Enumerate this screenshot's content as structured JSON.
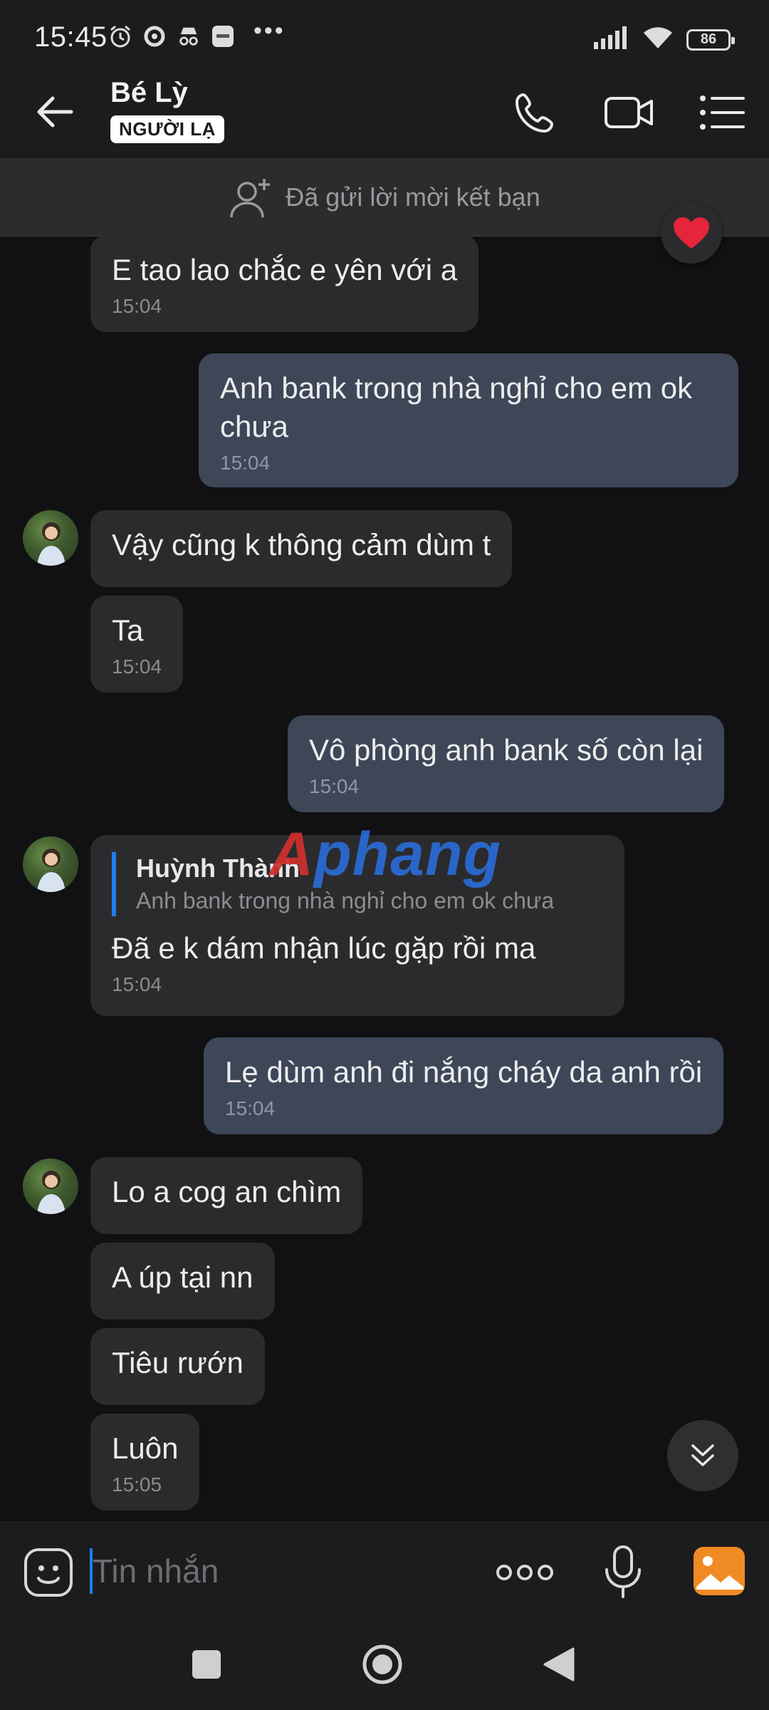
{
  "status_bar": {
    "time": "15:45",
    "battery": "86",
    "more_indicator": "•••",
    "icons": [
      "alarm-icon",
      "sync-icon",
      "incognito-icon",
      "app-icon",
      "signal-icon",
      "wifi-icon",
      "battery-icon"
    ]
  },
  "header": {
    "name": "Bé Lỳ",
    "badge": "NGƯỜI LẠ",
    "icons": [
      "back-arrow-icon",
      "phone-icon",
      "video-icon",
      "menu-list-icon"
    ]
  },
  "friend_banner": {
    "text": "Đã gửi lời mời kết bạn"
  },
  "messages": [
    {
      "dir": "in",
      "text": "E tao lao chắc e yên với a",
      "time": "15:04"
    },
    {
      "dir": "out",
      "text": "Anh bank trong nhà nghỉ cho em ok chưa",
      "time": "15:04"
    },
    {
      "dir": "in",
      "text": "Vậy cũng k thông cảm dùm t",
      "time": ""
    },
    {
      "dir": "in",
      "text": "Ta",
      "time": "15:04"
    },
    {
      "dir": "out",
      "text": "Vô phòng anh bank số còn lại",
      "time": "15:04"
    },
    {
      "dir": "in",
      "reply_name": "Huỳnh Thành",
      "reply_text": "Anh bank trong nhà nghỉ cho em ok chưa",
      "text": "Đã e k dám nhận lúc gặp rồi ma",
      "time": "15:04"
    },
    {
      "dir": "out",
      "text": "Lẹ dùm anh đi nắng cháy da anh rồi",
      "time": "15:04"
    },
    {
      "dir": "in",
      "text": "Lo a cog an chìm",
      "time": ""
    },
    {
      "dir": "in",
      "text": "A úp tại nn",
      "time": ""
    },
    {
      "dir": "in",
      "text": "Tiêu rướn",
      "time": ""
    },
    {
      "dir": "in",
      "text": "Luôn",
      "time": "15:05"
    }
  ],
  "watermark": {
    "first": "A",
    "rest": "phang"
  },
  "input": {
    "placeholder": "Tin nhắn"
  },
  "colors": {
    "background": "#111113",
    "incoming_bubble": "#2b2b2d",
    "outgoing_bubble": "#3d4758",
    "accent": "#1f7ef0",
    "image_button": "#f08a24"
  }
}
